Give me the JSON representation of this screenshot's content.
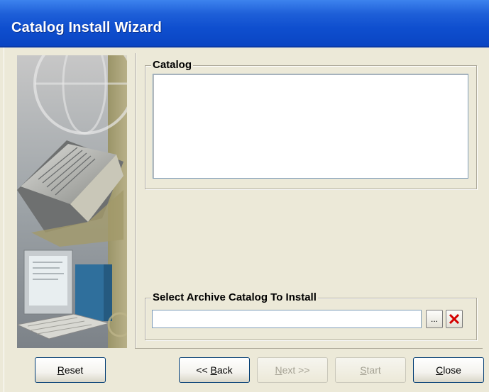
{
  "window": {
    "title": "Catalog Install Wizard"
  },
  "catalog_group": {
    "label": "Catalog",
    "items": []
  },
  "archive_group": {
    "label": "Select Archive Catalog To Install",
    "path_value": "",
    "browse_label": "...",
    "clear_icon": "red-x-icon"
  },
  "buttons": {
    "reset": {
      "prefix": "",
      "mnemonic": "R",
      "suffix": "eset"
    },
    "back": {
      "prefix": "<< ",
      "mnemonic": "B",
      "suffix": "ack"
    },
    "next": {
      "prefix": "",
      "mnemonic": "N",
      "suffix": "ext >>"
    },
    "start": {
      "prefix": "",
      "mnemonic": "S",
      "suffix": "tart"
    },
    "close": {
      "prefix": "",
      "mnemonic": "C",
      "suffix": "lose"
    }
  },
  "colors": {
    "titlebar": "#0a45c3",
    "face": "#ece9d8",
    "clear_icon": "#d40000"
  }
}
